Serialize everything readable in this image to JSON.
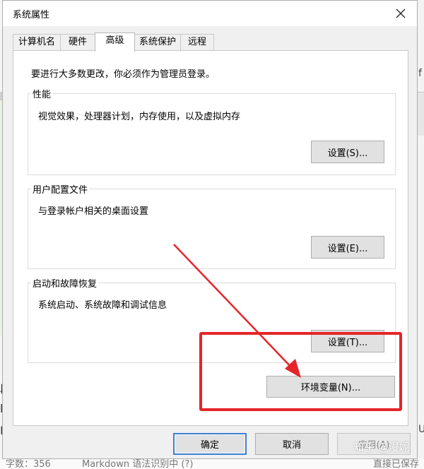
{
  "dialog": {
    "title": "系统属性",
    "tabs": [
      "计算机名",
      "硬件",
      "高级",
      "系统保护",
      "远程"
    ],
    "active_tab": "高级",
    "admin_note": "要进行大多数更改，你必须作为管理员登录。",
    "performance": {
      "title": "性能",
      "description": "视觉效果，处理器计划，内存使用，以及虚拟内存",
      "button": "设置(S)..."
    },
    "user_profiles": {
      "title": "用户配置文件",
      "description": "与登录帐户相关的桌面设置",
      "button": "设置(E)..."
    },
    "startup_recovery": {
      "title": "启动和故障恢复",
      "description": "系统启动、系统故障和调试信息",
      "button": "设置(T)..."
    },
    "env_button": "环境变量(N)...",
    "ok_button": "确定",
    "cancel_button": "取消",
    "apply_button": "应用(A)"
  },
  "background": {
    "status_count": "字数：356",
    "status_syntax": "Markdown 语法识别中 (?)",
    "status_right": "直接已保存"
  },
  "watermark": "知乎 @漫妮",
  "colors": {
    "annotation_red": "#e5252a",
    "dialog_bg": "#f0f0f0",
    "default_button_border": "#3c7fd6"
  }
}
